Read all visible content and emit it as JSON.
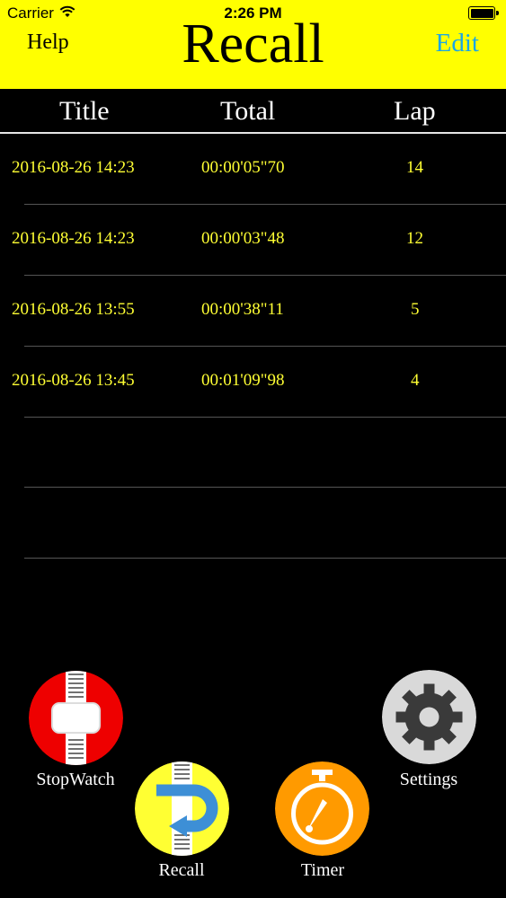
{
  "status": {
    "carrier": "Carrier",
    "time": "2:26 PM"
  },
  "nav": {
    "help": "Help",
    "title": "Recall",
    "edit": "Edit"
  },
  "columns": {
    "title": "Title",
    "total": "Total",
    "lap": "Lap"
  },
  "rows": [
    {
      "title": "2016-08-26 14:23",
      "total": "00:00'05\"70",
      "lap": "14"
    },
    {
      "title": "2016-08-26 14:23",
      "total": "00:00'03\"48",
      "lap": "12"
    },
    {
      "title": "2016-08-26 13:55",
      "total": "00:00'38\"11",
      "lap": "5"
    },
    {
      "title": "2016-08-26 13:45",
      "total": "00:01'09\"98",
      "lap": "4"
    }
  ],
  "tabs": {
    "stopwatch": "StopWatch",
    "recall": "Recall",
    "timer": "Timer",
    "settings": "Settings"
  },
  "colors": {
    "header": "#ffff00",
    "edit": "#19a6e6",
    "row_text": "#ffff33"
  },
  "icons": [
    "wifi-icon",
    "battery-icon",
    "stopwatch-icon",
    "recall-icon",
    "timer-icon",
    "gear-icon"
  ]
}
